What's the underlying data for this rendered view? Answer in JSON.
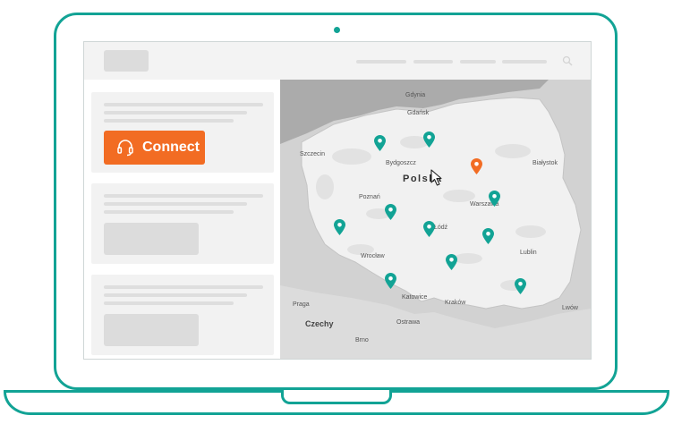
{
  "button": {
    "connect_label": "Connect",
    "color": "#f26c23"
  },
  "brand_color": "#12a395",
  "map": {
    "country_label": "Polska",
    "labels": {
      "gdynia": "Gdynia",
      "gdansk": "Gdańsk",
      "szczecin": "Szczecin",
      "bydgoszcz": "Bydgoszcz",
      "bialystok": "Białystok",
      "poznan": "Poznań",
      "warszawa": "Warszawa",
      "lodz": "Łódź",
      "wroclaw": "Wrocław",
      "lublin": "Lublin",
      "katowice": "Katowice",
      "krakow": "Kraków",
      "praga": "Praga",
      "czechy": "Czechy",
      "ostrawa": "Ostrawa",
      "brno": "Brno",
      "lwow": "Lwów"
    },
    "pin_colors": {
      "default": "#12a395",
      "highlight": "#f26c23"
    }
  }
}
